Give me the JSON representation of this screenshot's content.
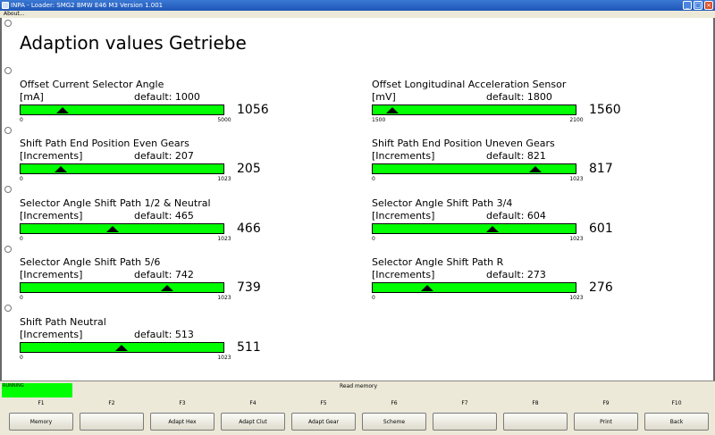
{
  "window": {
    "title": "INPA - Loader: SMG2 BMW E46 M3 Version 1.001",
    "minimize_label": "_",
    "maximize_label": "□",
    "close_label": "×"
  },
  "menu": {
    "about": "About..."
  },
  "page_title": "Adaption values Getriebe",
  "colors": {
    "gauge_fill": "#00ff00",
    "status_running": "#00ff00",
    "title_bar": "#1f56b8"
  },
  "gauges": [
    {
      "title": "Offset Current Selector Angle",
      "unit": "[mA]",
      "default": "default: 1000",
      "min": "0",
      "max": "5000",
      "min_value": 0,
      "max_value": 5000,
      "current": 1056,
      "value_text": "1056"
    },
    {
      "title": "Offset Longitudinal Acceleration Sensor",
      "unit": "[mV]",
      "default": "default: 1800",
      "min": "1500",
      "max": "2100",
      "min_value": 1500,
      "max_value": 2100,
      "current": 1560,
      "value_text": "1560"
    },
    {
      "title": "Shift Path End Position Even Gears",
      "unit": "[Increments]",
      "default": "default: 207",
      "min": "0",
      "max": "1023",
      "min_value": 0,
      "max_value": 1023,
      "current": 205,
      "value_text": "205"
    },
    {
      "title": "Shift Path End Position Uneven Gears",
      "unit": "[Increments]",
      "default": "default: 821",
      "min": "0",
      "max": "1023",
      "min_value": 0,
      "max_value": 1023,
      "current": 817,
      "value_text": "817"
    },
    {
      "title": "Selector Angle Shift Path 1/2 & Neutral",
      "unit": "[Increments]",
      "default": "default: 465",
      "min": "0",
      "max": "1023",
      "min_value": 0,
      "max_value": 1023,
      "current": 466,
      "value_text": "466"
    },
    {
      "title": "Selector Angle Shift Path 3/4",
      "unit": "[Increments]",
      "default": "default: 604",
      "min": "0",
      "max": "1023",
      "min_value": 0,
      "max_value": 1023,
      "current": 601,
      "value_text": "601"
    },
    {
      "title": "Selector Angle Shift Path 5/6",
      "unit": "[Increments]",
      "default": "default: 742",
      "min": "0",
      "max": "1023",
      "min_value": 0,
      "max_value": 1023,
      "current": 739,
      "value_text": "739"
    },
    {
      "title": "Selector Angle Shift Path R",
      "unit": "[Increments]",
      "default": "default: 273",
      "min": "0",
      "max": "1023",
      "min_value": 0,
      "max_value": 1023,
      "current": 276,
      "value_text": "276"
    },
    {
      "title": "Shift Path Neutral",
      "unit": "[Increments]",
      "default": "default: 513",
      "min": "0",
      "max": "1023",
      "min_value": 0,
      "max_value": 1023,
      "current": 511,
      "value_text": "511"
    }
  ],
  "status": {
    "running": "RUNNING",
    "message": "Read memory"
  },
  "fkeys": [
    {
      "key": "F1",
      "label": "Memory"
    },
    {
      "key": "F2",
      "label": ""
    },
    {
      "key": "F3",
      "label": "Adapt Hex"
    },
    {
      "key": "F4",
      "label": "Adapt Clut"
    },
    {
      "key": "F5",
      "label": "Adapt Gear"
    },
    {
      "key": "F6",
      "label": "Scheme"
    },
    {
      "key": "F7",
      "label": ""
    },
    {
      "key": "F8",
      "label": ""
    },
    {
      "key": "F9",
      "label": "Print"
    },
    {
      "key": "F10",
      "label": "Back"
    }
  ]
}
